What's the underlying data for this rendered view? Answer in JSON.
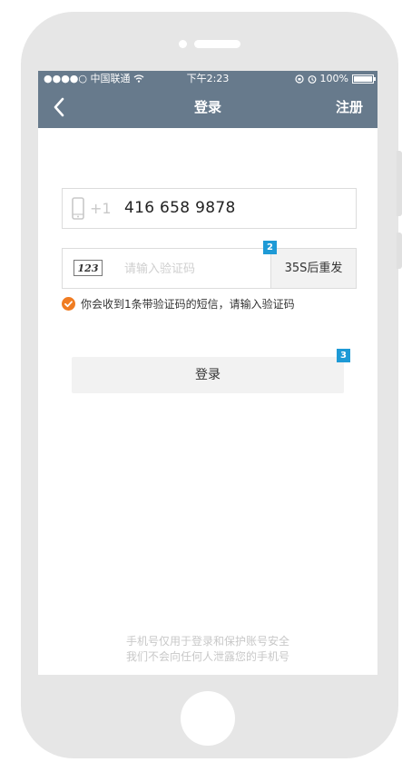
{
  "status_bar": {
    "signal": "●●●●○",
    "carrier": "中国联通",
    "wifi_icon": "wifi-icon",
    "time": "下午2:23",
    "battery": "100%",
    "battery_level": 1.0
  },
  "nav": {
    "title": "登录",
    "right_label": "注册",
    "back_icon": "chevron-left-icon"
  },
  "phone_field": {
    "icon": "mobile-phone-icon",
    "country_code": "+1",
    "value": "416 658 9878"
  },
  "code_field": {
    "icon_text": "123",
    "placeholder": "请输入验证码",
    "resend_label": "35S后重发"
  },
  "badges": {
    "code": "2",
    "login": "3"
  },
  "notice": {
    "icon": "check-circle-icon",
    "text": "你会收到1条带验证码的短信，请输入验证码"
  },
  "login_button": {
    "label": "登录"
  },
  "footer": {
    "line1": "手机号仅用于登录和保护账号安全",
    "line2": "我们不会向任何人泄露您的手机号"
  },
  "colors": {
    "nav_bg": "#677a8c",
    "badge_bg": "#1e9ad6",
    "notice_icon": "#f07c22",
    "phone_frame": "#e6e6e6"
  }
}
